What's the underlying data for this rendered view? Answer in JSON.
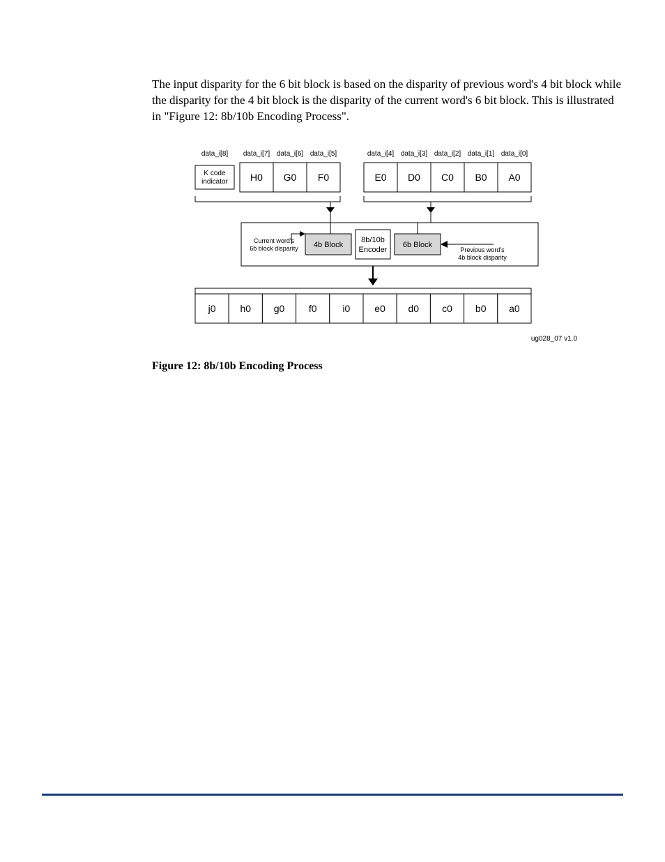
{
  "para": "The input disparity for the 6 bit block is based on the disparity of previous word's 4 bit block while the disparity for the 4 bit block is the disparity of the current word's 6 bit block. This is illustrated in \"Figure 12: 8b/10b Encoding Process\".",
  "caption": "Figure 12: 8b/10b Encoding Process",
  "fig": {
    "topLabels": [
      "data_i[8]",
      "data_i[7]",
      "data_i[6]",
      "data_i[5]",
      "data_i[4]",
      "data_i[3]",
      "data_i[2]",
      "data_i[1]",
      "data_i[0]"
    ],
    "kcode1": "K code",
    "kcode2": "indicator",
    "topBoxes": [
      "H0",
      "G0",
      "F0",
      "E0",
      "D0",
      "C0",
      "B0",
      "A0"
    ],
    "midLeft1": "Current word's",
    "midLeft2": "6b block disparity",
    "mid4b": "4b Block",
    "enc1": "8b/10b",
    "enc2": "Encoder",
    "mid6b": "6b Block",
    "midRight1": "Previous word's",
    "midRight2": "4b block disparity",
    "botBoxes": [
      "j0",
      "h0",
      "g0",
      "f0",
      "i0",
      "e0",
      "d0",
      "c0",
      "b0",
      "a0"
    ],
    "tag": "ug028_07 v1.0"
  }
}
